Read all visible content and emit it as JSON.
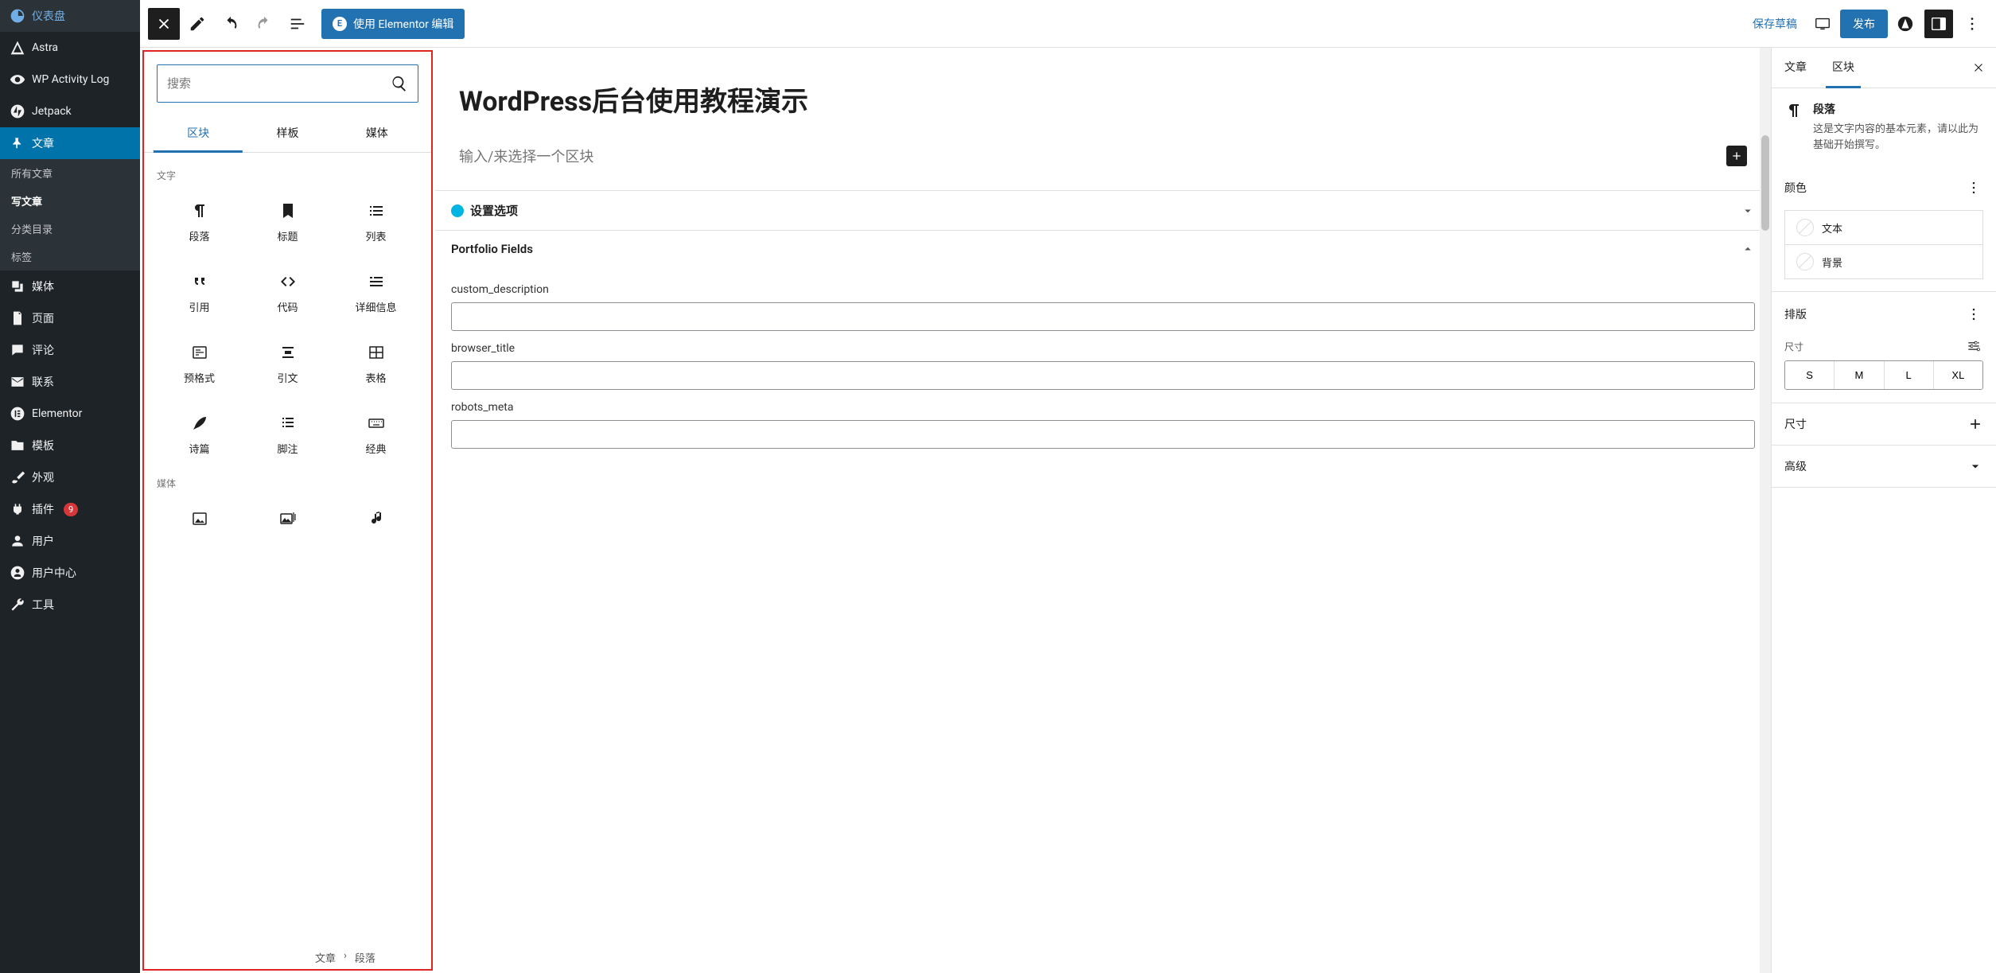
{
  "admin_sidebar": {
    "dashboard": "仪表盘",
    "astra": "Astra",
    "activity_log": "WP Activity Log",
    "jetpack": "Jetpack",
    "posts": "文章",
    "posts_sub": {
      "all": "所有文章",
      "new": "写文章",
      "categories": "分类目录",
      "tags": "标签"
    },
    "media": "媒体",
    "pages": "页面",
    "comments": "评论",
    "contact": "联系",
    "elementor": "Elementor",
    "templates": "模板",
    "appearance": "外观",
    "plugins": "插件",
    "plugins_count": "9",
    "users": "用户",
    "user_center": "用户中心",
    "tools": "工具"
  },
  "toolbar": {
    "elementor_label": "使用 Elementor 编辑",
    "save_draft": "保存草稿",
    "publish": "发布"
  },
  "inserter": {
    "search_placeholder": "搜索",
    "tabs": {
      "blocks": "区块",
      "patterns": "样板",
      "media": "媒体"
    },
    "section_text": "文字",
    "section_media": "媒体",
    "blocks": {
      "paragraph": "段落",
      "heading": "标题",
      "list": "列表",
      "quote": "引用",
      "code": "代码",
      "details": "详细信息",
      "preformatted": "预格式",
      "pullquote": "引文",
      "table": "表格",
      "verse": "诗篇",
      "footnotes": "脚注",
      "classic": "经典"
    }
  },
  "canvas": {
    "title": "WordPress后台使用教程演示",
    "prompt": "输入/来选择一个区块",
    "settings_panel": "设置选项",
    "portfolio_panel": "Portfolio Fields",
    "field1": "custom_description",
    "field2": "browser_title",
    "field3": "robots_meta",
    "breadcrumb_post": "文章",
    "breadcrumb_block": "段落"
  },
  "settings": {
    "tab_post": "文章",
    "tab_block": "区块",
    "block_name": "段落",
    "block_desc": "这是文字内容的基本元素，请以此为基础开始撰写。",
    "color_panel": "颜色",
    "color_text": "文本",
    "color_bg": "背景",
    "typography_panel": "排版",
    "size_label": "尺寸",
    "sizes": {
      "s": "S",
      "m": "M",
      "l": "L",
      "xl": "XL"
    },
    "dimensions_panel": "尺寸",
    "advanced_panel": "高级"
  }
}
